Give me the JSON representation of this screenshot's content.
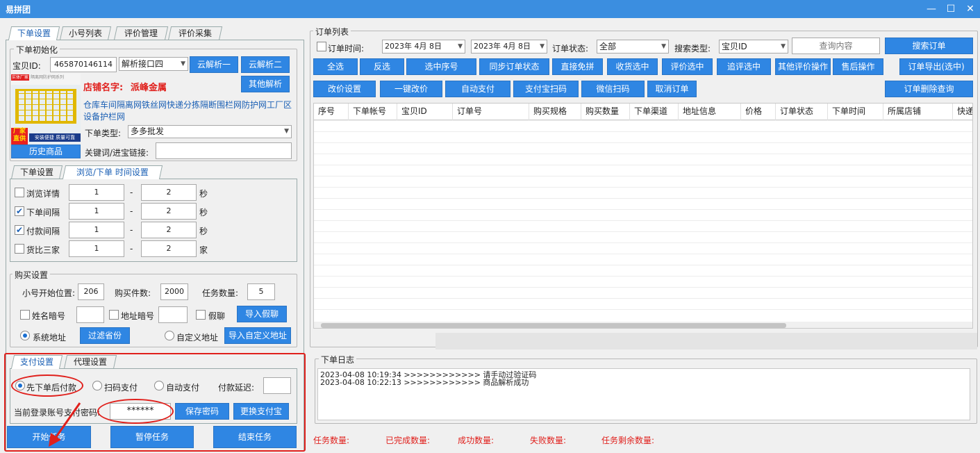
{
  "app": {
    "title": "易拼团"
  },
  "left_tabs": [
    "下单设置",
    "小号列表",
    "评价管理",
    "评价采集"
  ],
  "init": {
    "group": "下单初始化",
    "item_id_label": "宝贝ID:",
    "item_id": "465870146114",
    "api_select": "解析接口四",
    "cloud1": "云解析一",
    "cloud2": "云解析二",
    "other_parse": "其他解析",
    "shop_label": "店铺名字:",
    "shop_name": "派峰金属",
    "product_title": "仓库车间隔离网铁丝网快递分拣隔断围栏网防护网工厂区设备护栏网",
    "order_type_label": "下单类型:",
    "order_type": "多多批发",
    "history_btn": "历史商品",
    "keyword_label": "关键词/进宝链接:",
    "thumb_text": {
      "corner": "实体厂家",
      "badge": "厂家直供",
      "bar": "安装便捷 质量可靠",
      "top": "隔离网防护网系列"
    }
  },
  "sub_tabs": [
    "下单设置",
    "浏览/下单 时间设置"
  ],
  "timing": [
    {
      "label": "浏览详情",
      "checked": false,
      "min": "1",
      "max": "2",
      "unit": "秒"
    },
    {
      "label": "下单间隔",
      "checked": true,
      "min": "1",
      "max": "2",
      "unit": "秒"
    },
    {
      "label": "付款间隔",
      "checked": true,
      "min": "1",
      "max": "2",
      "unit": "秒"
    },
    {
      "label": "货比三家",
      "checked": false,
      "min": "1",
      "max": "2",
      "unit": "家"
    }
  ],
  "dash": "-",
  "check_mark": "✔",
  "purchase": {
    "group": "购买设置",
    "start_label": "小号开始位置:",
    "start": "206",
    "qty_label": "购买件数:",
    "qty": "2000",
    "task_label": "任务数量:",
    "task": "5",
    "name_code": "姓名暗号",
    "addr_code": "地址暗号",
    "fake_chat": "假聊",
    "import_fake": "导入假聊",
    "sys_addr": "系统地址",
    "filter_prov": "过滤省份",
    "custom_addr": "自定义地址",
    "import_custom": "导入自定义地址"
  },
  "pay_tabs": [
    "支付设置",
    "代理设置"
  ],
  "pay": {
    "opt1": "先下单后付款",
    "opt2": "扫码支付",
    "opt3": "自动支付",
    "delay_label": "付款延迟:",
    "pwd_label": "当前登录账号支付密码:",
    "pwd": "******",
    "save_pwd": "保存密码",
    "change_alipay": "更换支付宝"
  },
  "actions": {
    "start": "开始任务",
    "pause": "暂停任务",
    "end": "结束任务"
  },
  "orders": {
    "group": "订单列表",
    "time_label": "订单时间:",
    "date1": "2023年 4月 8日",
    "date2": "2023年 4月 8日",
    "status_label": "订单状态:",
    "status": "全部",
    "search_type_label": "搜索类型:",
    "search_type": "宝贝ID",
    "query_placeholder": "查询内容",
    "search_btn": "搜索订单",
    "row1": [
      "全选",
      "反选",
      "选中序号",
      "同步订单状态",
      "直接免拼",
      "收货选中",
      "评价选中",
      "追评选中",
      "其他评价操作",
      "售后操作",
      "订单导出(选中)"
    ],
    "row2": [
      "改价设置",
      "一键改价",
      "自动支付",
      "支付宝扫码",
      "微信扫码",
      "取消订单"
    ],
    "delete_query": "订单删除查询",
    "columns": [
      "序号",
      "下单帐号",
      "宝贝ID",
      "订单号",
      "购买规格",
      "购买数量",
      "下单渠道",
      "地址信息",
      "价格",
      "订单状态",
      "下单时间",
      "所属店铺",
      "快递"
    ]
  },
  "log": {
    "group": "下单日志",
    "lines": [
      "2023-04-08 10:19:34 >>>>>>>>>>>> 请手动过验证码",
      "2023-04-08 10:22:13 >>>>>>>>>>>> 商品解析成功"
    ]
  },
  "stats": [
    "任务数量:",
    "已完成数量:",
    "成功数量:",
    "失败数量:",
    "任务剩余数量:"
  ],
  "colors": {
    "accent": "#2f86e3",
    "title": "#3b8ee0",
    "alert": "#e0201c"
  }
}
